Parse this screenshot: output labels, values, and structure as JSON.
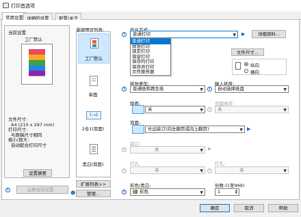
{
  "window": {
    "title": "打印首选项"
  },
  "tabs": [
    "常用设置",
    "详细的设置",
    "配置/关于"
  ],
  "left": {
    "current_settings_label": "当前设置",
    "current_settings_value": "工厂默认",
    "info_lines": [
      "文件尺寸:",
      "A4 (210 x 297 mm)",
      "打印尺寸:",
      "与原稿尺寸相同",
      "缩小/放大:",
      "自动配合打印尺寸"
    ],
    "summary_button": "设置摘要",
    "register_button": "注册当前设置..."
  },
  "presets": {
    "label": "单键预设列表:",
    "items": [
      {
        "label": "工厂默认",
        "selected": true
      },
      {
        "label": "单面",
        "selected": false
      },
      {
        "label": "2合1(双面)",
        "selected": false,
        "glyph": "1→2"
      },
      {
        "label": "黑白(双面)",
        "selected": false
      }
    ],
    "expand_button": "扩展列表>>",
    "manage_button": "管理..."
  },
  "job": {
    "label": "作业方式:",
    "value": "普通打印",
    "options": [
      "普通打印",
      "样张打印",
      "锁定打印",
      "保留打印",
      "保存的打印",
      "保存并打印",
      "文件服务器"
    ],
    "highlighted_index": 0,
    "details_button": "详细资料..."
  },
  "paper_size_button": "文件尺寸...",
  "orientation": {
    "portrait": "纵向",
    "landscape": "横向",
    "selected": "portrait"
  },
  "paper_type": {
    "label": "纸张类型:",
    "value": "普通纸和再生纸"
  },
  "input_tray": {
    "label": "输入纸盘:",
    "value": "自动选择纸盘"
  },
  "duplex_layout": {
    "label": "版面:",
    "value": "关"
  },
  "page_order": {
    "label": "页面顺序:",
    "value": "关"
  },
  "duplex": {
    "label": "双面:",
    "value": "长边装订(向左翻页或向上翻页)"
  },
  "staple": {
    "label": "装订:",
    "value": "关"
  },
  "punch": {
    "label": "打孔:",
    "value": "关"
  },
  "fold": {
    "label": "打孔:",
    "value": "关"
  },
  "color": {
    "label": "彩色/黑白:",
    "value": "彩色"
  },
  "copies": {
    "label": "份数:(1至999)",
    "value": "1"
  },
  "footer": {
    "ok": "确定",
    "cancel": "取消",
    "help": "帮助"
  },
  "colors": {
    "highlight": "#0078d7",
    "info": "#1a5fb4"
  }
}
